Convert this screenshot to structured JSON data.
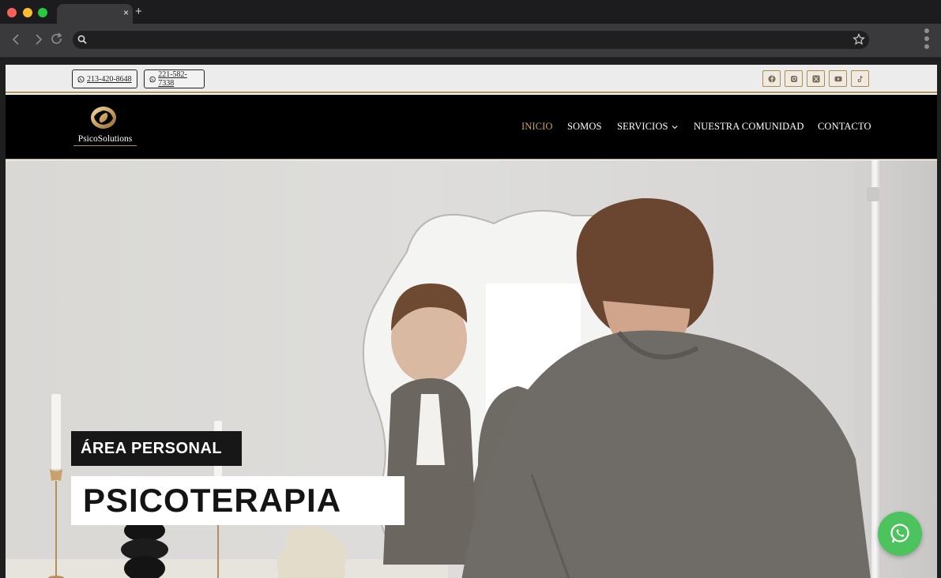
{
  "browser": {
    "tab_close": "×",
    "new_tab": "+",
    "address": ""
  },
  "topbar": {
    "phones": [
      {
        "number": "213-420-8648",
        "icon": "whatsapp-icon"
      },
      {
        "number": "221-582-7338",
        "icon": "whatsapp-icon"
      }
    ],
    "social_icons": [
      "facebook-icon",
      "instagram-icon",
      "x-twitter-icon",
      "youtube-icon",
      "tiktok-icon"
    ]
  },
  "header": {
    "logo_text": "PsicoSolutions",
    "nav": [
      {
        "label": "INICIO",
        "active": true
      },
      {
        "label": "SOMOS",
        "active": false
      },
      {
        "label": "SERVICIOS",
        "active": false,
        "has_dropdown": true
      },
      {
        "label": "NUESTRA COMUNIDAD",
        "active": false
      },
      {
        "label": "CONTACTO",
        "active": false
      }
    ]
  },
  "hero": {
    "kicker": "ÁREA PERSONAL",
    "title": "PSICOTERAPIA"
  },
  "floating": {
    "whatsapp_icon": "whatsapp-icon"
  },
  "colors": {
    "gold_accent": "#c8a46a",
    "header_bg": "#000000",
    "whatsapp_green": "#4cc35c"
  }
}
